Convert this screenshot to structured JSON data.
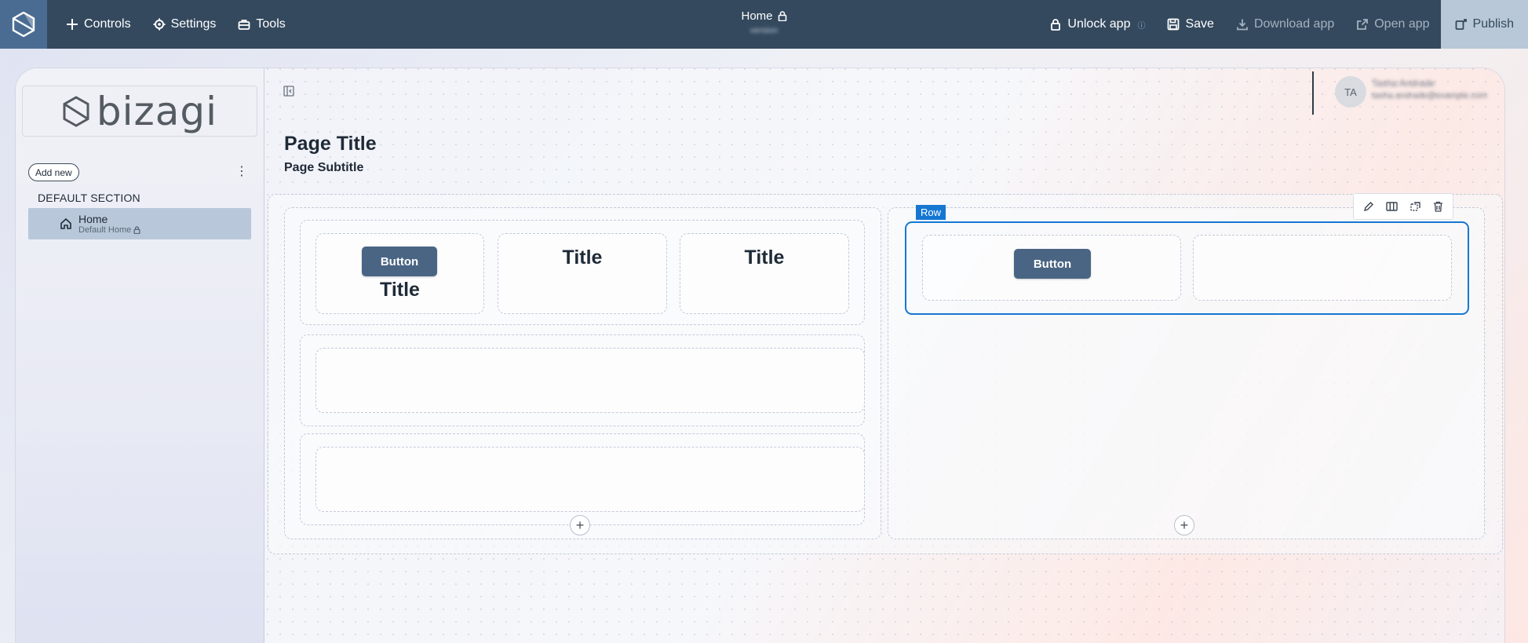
{
  "topbar": {
    "controls_label": "Controls",
    "settings_label": "Settings",
    "tools_label": "Tools",
    "page_name": "Home",
    "page_sub": "version",
    "unlock_label": "Unlock app",
    "save_label": "Save",
    "download_label": "Download app",
    "open_label": "Open app",
    "publish_label": "Publish"
  },
  "sidebar": {
    "brand": "bizagi",
    "add_new_label": "Add new",
    "section_label": "DEFAULT SECTION",
    "items": [
      {
        "label": "Home",
        "sublabel": "Default Home"
      }
    ]
  },
  "user": {
    "initials": "TA",
    "name": "Tasha Andrade",
    "email": "tasha.andrade@example.com"
  },
  "page": {
    "title": "Page Title",
    "subtitle": "Page Subtitle"
  },
  "canvas": {
    "left_column": {
      "row1": {
        "cell1": {
          "button_label": "Button",
          "title": "Title"
        },
        "cell2": {
          "title": "Title"
        },
        "cell3": {
          "title": "Title"
        }
      }
    },
    "right_column": {
      "row_tag": "Row",
      "cell1": {
        "button_label": "Button"
      }
    }
  },
  "colors": {
    "topbar": "#34495e",
    "accent": "#1677d2",
    "button": "#4a6584",
    "publish_bg": "#b8c8d8"
  }
}
